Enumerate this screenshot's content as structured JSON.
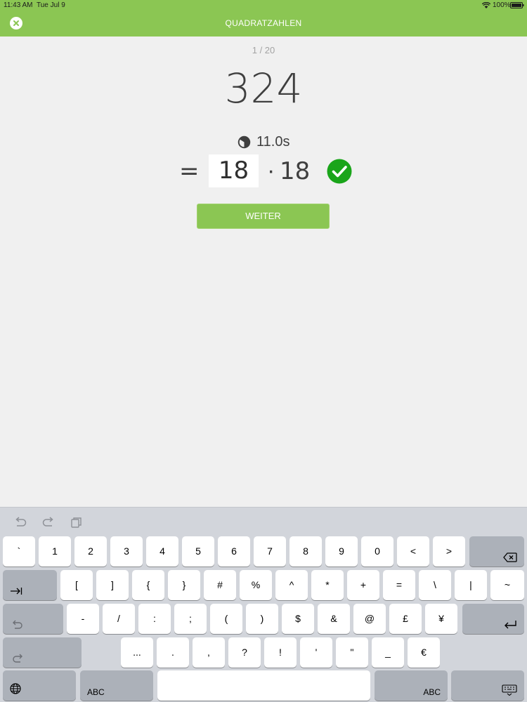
{
  "status_bar": {
    "time": "11:43 AM",
    "date": "Tue Jul 9",
    "battery": "100%"
  },
  "header": {
    "title": "QUADRATZAHLEN"
  },
  "quiz": {
    "progress": "1 / 20",
    "question": "324",
    "timer": "11.0s",
    "equals": "=",
    "answer_value": "18",
    "dot": "·",
    "factor": "18",
    "next_label": "WEITER"
  },
  "keyboard": {
    "row1": [
      "`",
      "1",
      "2",
      "3",
      "4",
      "5",
      "6",
      "7",
      "8",
      "9",
      "0",
      "<",
      ">"
    ],
    "row2": [
      "[",
      "]",
      "{",
      "}",
      "#",
      "%",
      "^",
      "*",
      "+",
      "=",
      "\\",
      "|",
      "~"
    ],
    "row3": [
      "-",
      "/",
      ":",
      ";",
      "(",
      ")",
      "$",
      "&",
      "@",
      "£",
      "¥"
    ],
    "row4": [
      "...",
      ".",
      ",",
      "?",
      "!",
      "'",
      "\"",
      "_",
      "€"
    ],
    "abc_left": "ABC",
    "abc_right": "ABC"
  },
  "colors": {
    "accent": "#8bc653",
    "success": "#1aa51a",
    "background": "#f0f0f0"
  }
}
